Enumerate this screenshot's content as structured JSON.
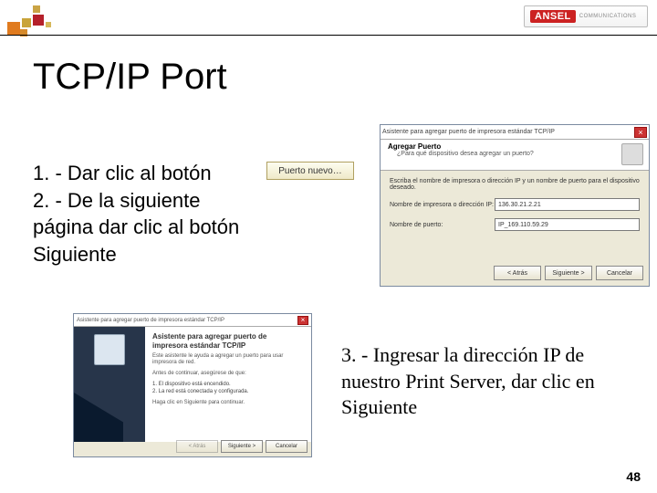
{
  "brand": {
    "name": "ANSEL",
    "sub": "COMMUNICATIONS"
  },
  "title": "TCP/IP Port",
  "steps": {
    "s1": "1. - Dar clic al botón",
    "s2": "2. -  De la siguiente página dar clic al botón Siguiente",
    "s3": "3. - Ingresar la dirección IP de nuestro Print Server, dar clic en Siguiente"
  },
  "button_nuevo": "Puerto nuevo…",
  "wizard2": {
    "titlebar": "Asistente para agregar puerto de impresora estándar TCP/IP",
    "header_title": "Agregar Puerto",
    "header_sub": "¿Para qué dispositivo desea agregar un puerto?",
    "body_text": "Escriba el nombre de impresora o dirección IP y un nombre de puerto para el dispositivo deseado.",
    "field1_label": "Nombre de impresora o dirección IP:",
    "field1_value": "136.30.21.2.21",
    "field2_label": "Nombre de puerto:",
    "field2_value": "IP_169.110.59.29",
    "btn_back": "< Atrás",
    "btn_next": "Siguiente >",
    "btn_cancel": "Cancelar"
  },
  "wizard1": {
    "titlebar": "Asistente para agregar puerto de impresora estándar TCP/IP",
    "wtitle": "Asistente para agregar puerto de impresora estándar TCP/IP",
    "p1": "Este asistente le ayuda a agregar un puerto para usar impresora de red.",
    "p2": "Antes de continuar, asegúrese de que:",
    "chk1": "1. El dispositivo está encendido.",
    "chk2": "2. La red está conectada y configurada.",
    "p3": "Haga clic en Siguiente para continuar.",
    "btn_back": "< Atrás",
    "btn_next": "Siguiente >",
    "btn_cancel": "Cancelar"
  },
  "page_number": "48"
}
